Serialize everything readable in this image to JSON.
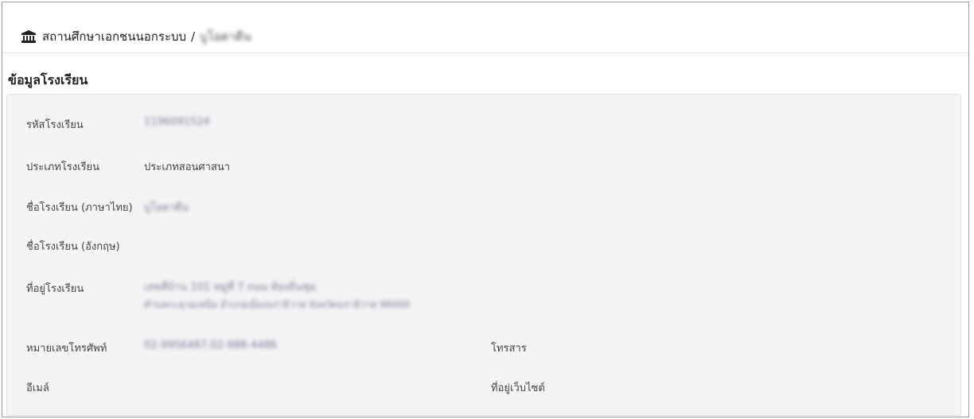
{
  "breadcrumb": {
    "root": "สถานศึกษาเอกชนนอกระบบ",
    "separator": "/",
    "current": "บูโอตาดีน"
  },
  "section_title": "ข้อมูลโรงเรียน",
  "fields": {
    "school_code": {
      "label": "รหัสโรงเรียน",
      "value": "1196091524"
    },
    "school_type": {
      "label": "ประเภทโรงเรียน",
      "value": "ประเภทสอนศาสนา"
    },
    "name_th": {
      "label": "ชื่อโรงเรียน (ภาษาไทย)",
      "value": "บูโอตาดีน"
    },
    "name_en": {
      "label": "ชื่อโรงเรียน (อังกฤษ)",
      "value": ""
    },
    "address": {
      "label": "ที่อยู่โรงเรียน",
      "line1": "เลขที่บ้าน 101 หมู่ที่ 7 ถนน ท้องถิ่นชุม",
      "line2": "ตำบลกะลุวอเหนือ อำเภอเมืองนราธิวาส จังหวัดนราธิวาส 96000"
    },
    "phone": {
      "label": "หมายเลขโทรศัพท์",
      "value": "02-9956487,02-988-4486"
    },
    "fax": {
      "label": "โทรสาร",
      "value": ""
    },
    "email": {
      "label": "อีเมล์",
      "value": ""
    },
    "website": {
      "label": "ที่อยู่เว็บไซต์",
      "value": ""
    }
  },
  "icons": {
    "breadcrumb_icon": "bank-icon"
  }
}
